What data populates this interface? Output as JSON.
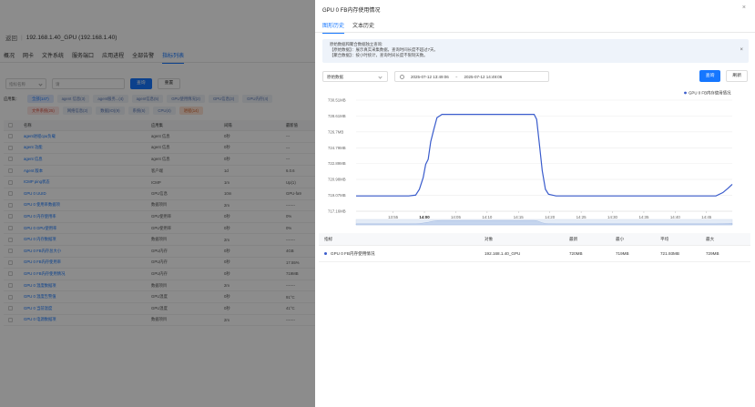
{
  "background": {
    "breadcrumb": {
      "back": "返回",
      "host": "192.168.1.40_GPU (192.168.1.40)"
    },
    "tabs": [
      "概况",
      "网卡",
      "文件系统",
      "服务端口",
      "应用进程",
      "全部告警",
      "指标列表"
    ],
    "filter": {
      "select_placeholder": "指标名称",
      "search_placeholder": "请",
      "query_label": "查询",
      "reset_label": "重置"
    },
    "categories": {
      "label": "应用集：",
      "row1": [
        "全部(147)",
        "agent 信息(3)",
        "agent服务...(4)",
        "agent信息(5)",
        "GPU使用情况(2)",
        "GPU信息(3)",
        "GPU内存(4)"
      ],
      "row2": [
        "文件系统(25)",
        "网络信息(2)",
        "数据(IO)(9)",
        "系统(5)",
        "CPU(4)",
        "进程(14)"
      ]
    },
    "table": {
      "headers": [
        "名称",
        "应用集",
        "间隔",
        "最新值"
      ],
      "rows": [
        [
          "agent进程cpu负载",
          "agent 信息",
          "0秒",
          "---"
        ],
        [
          "agent 功能",
          "agent 信息",
          "0秒",
          "---"
        ],
        [
          "agent 信息",
          "agent 信息",
          "0秒",
          "---"
        ],
        [
          "Agent 版本",
          "客户端",
          "1d",
          "6.0.6"
        ],
        [
          "ICMP ping状态",
          "ICMP",
          "1m",
          "Up(1)"
        ],
        [
          "GPU 0 UUID",
          "GPU信息",
          "10m",
          "GPU-fa9"
        ],
        [
          "GPU 0 使用率数据项",
          "数据项目",
          "2m",
          "-------"
        ],
        [
          "GPU 0 内存使用率",
          "GPU使用率",
          "0秒",
          "0%"
        ],
        [
          "GPU 0 GPU使用率",
          "GPU使用率",
          "0秒",
          "0%"
        ],
        [
          "GPU 0 内存数据项",
          "数据项目",
          "2m",
          "-------"
        ],
        [
          "GPU 0 FB内存总大小",
          "GPU内存",
          "0秒",
          "4GB"
        ],
        [
          "GPU 0 FB内存使用率",
          "GPU内存",
          "0秒",
          "17.55%"
        ],
        [
          "GPU 0 FB内存使用情况",
          "GPU内存",
          "0秒",
          "719MB"
        ],
        [
          "GPU 0 温度数据项",
          "数据项目",
          "2m",
          "-------"
        ],
        [
          "GPU 0 温度告警值",
          "GPU温度",
          "0秒",
          "91°C"
        ],
        [
          "GPU 0 当前温度",
          "GPU温度",
          "0秒",
          "41°C"
        ],
        [
          "GPU 0 电源数据项",
          "数据项目",
          "2m",
          "-------"
        ]
      ]
    }
  },
  "drawer": {
    "title": "GPU 0 FB内存使用情况",
    "close_glyph": "×",
    "tabs": [
      "图形历史",
      "文本历史"
    ],
    "alert": {
      "lines": [
        "原始数据和聚合数据独立查询:",
        "【原始数据】：展示真实采集数据，查询时间长度不超过7天。",
        "【聚合数据】：按小时统计，查询时间长度不限制天数。"
      ],
      "close_glyph": "×"
    },
    "filter": {
      "select_value": "原始数据",
      "start": "2025-07-12 13:49:06",
      "range_sep": "~",
      "end": "2025-07-12 14:49:06",
      "query_label": "查询",
      "refresh_label": "刷新"
    },
    "table": {
      "headers": [
        "指标",
        "对象",
        "最新",
        "最小",
        "平均",
        "最大"
      ],
      "rows": [
        [
          "GPU 0 FB内存使用情况",
          "192.168.1.40_GPU",
          "720MB",
          "719MB",
          "721.93MB",
          "729MB"
        ]
      ]
    }
  },
  "chart_data": {
    "type": "line",
    "legend": {
      "position": "top-right"
    },
    "series": [
      {
        "name": "GPU 0 FB内存使用情况",
        "color": "#3a5ccc"
      }
    ],
    "y_ticks": [
      "717.16MB",
      "719.07MB",
      "720.98MB",
      "722.89MB",
      "724.79MB",
      "726.7MB",
      "728.61MB",
      "730.51MB"
    ],
    "y_tick_values": [
      717.16,
      719.07,
      720.98,
      722.89,
      724.79,
      726.7,
      728.61,
      730.51
    ],
    "ylim": [
      717.16,
      730.51
    ],
    "x_ticks": [
      "13:55",
      "14:00",
      "14:05",
      "14:10",
      "14:15",
      "14:20",
      "14:25",
      "14:30",
      "14:35",
      "14:40",
      "14:45"
    ],
    "x_tick_minutes": [
      835,
      840,
      845,
      850,
      855,
      860,
      865,
      870,
      875,
      880,
      885
    ],
    "xlim_minutes": [
      829.1,
      889.1
    ],
    "grid": "horizontal",
    "points": [
      [
        829.1,
        719.0
      ],
      [
        835.0,
        719.0
      ],
      [
        837.5,
        719.0
      ],
      [
        838.6,
        719.1
      ],
      [
        839.2,
        719.8
      ],
      [
        839.8,
        721.2
      ],
      [
        840.2,
        722.8
      ],
      [
        840.6,
        723.4
      ],
      [
        841.0,
        725.5
      ],
      [
        841.5,
        727.0
      ],
      [
        842.0,
        728.4
      ],
      [
        842.8,
        728.8
      ],
      [
        845.0,
        728.8
      ],
      [
        850.0,
        728.8
      ],
      [
        855.0,
        728.8
      ],
      [
        857.5,
        728.8
      ],
      [
        857.9,
        728.2
      ],
      [
        858.3,
        725.5
      ],
      [
        858.8,
        722.0
      ],
      [
        859.3,
        719.8
      ],
      [
        859.8,
        719.2
      ],
      [
        861.0,
        719.0
      ],
      [
        870.0,
        719.0
      ],
      [
        880.0,
        719.0
      ],
      [
        886.5,
        719.0
      ],
      [
        887.6,
        719.4
      ],
      [
        888.4,
        719.9
      ],
      [
        889.1,
        720.4
      ]
    ]
  }
}
